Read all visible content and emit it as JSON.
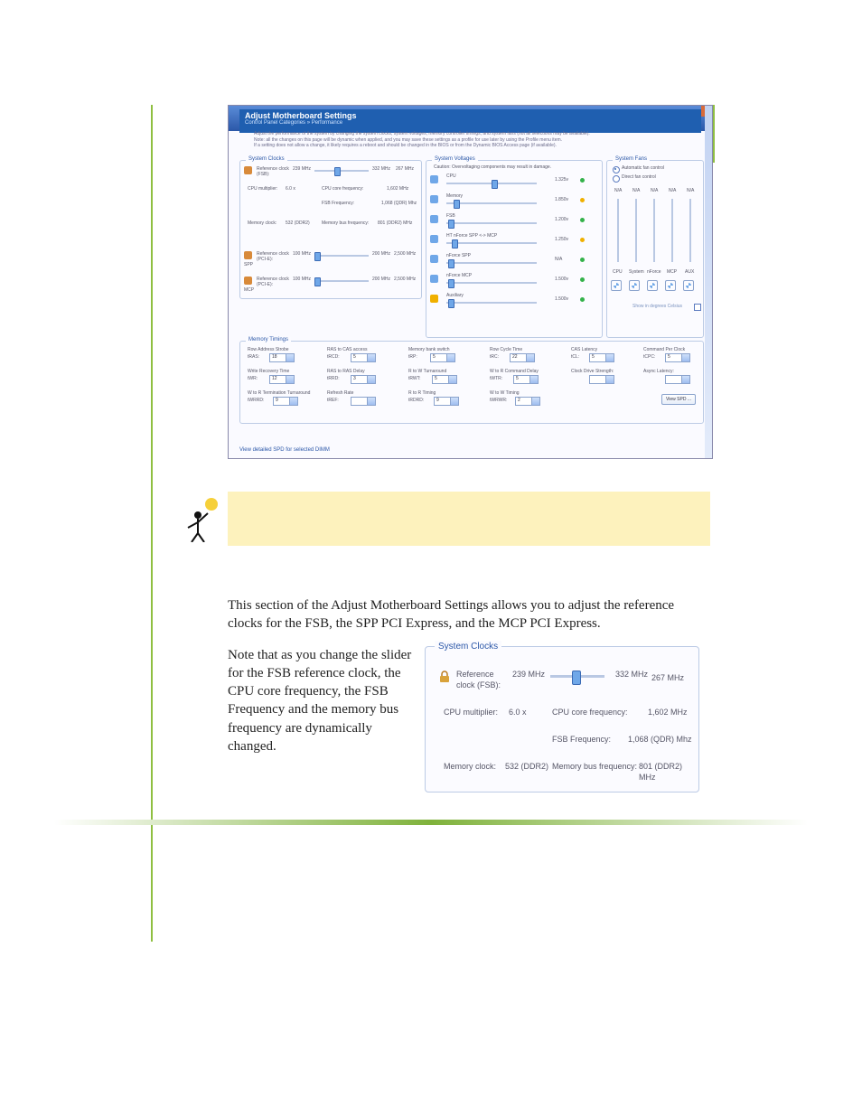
{
  "big": {
    "title": "Adjust Motherboard Settings",
    "breadcrumb": "Control Panel Categories  »  Performance",
    "desc1": "Adjust the performance of the system by changing the system clocks, system voltages, memory controller timings, and system fans (not all selections may be available).",
    "desc2": "Note: all the changes on this page will be dynamic when applied, and you may save these settings as a profile for use later by using the Profile menu item.",
    "desc3": "If a setting does not allow a change, it likely requires a reboot and should be changed in the BIOS or from the Dynamic BIOS Access page (if available).",
    "sysclocks": {
      "title": "System Clocks",
      "ref_fsb_lbl": "Reference clock (FSB):",
      "ref_fsb_val": "239 MHz",
      "ref_fsb_max": "332 MHz",
      "ref_fsb_rate": "267 MHz",
      "cpu_mult_lbl": "CPU multiplier:",
      "cpu_mult_val": "6.0 x",
      "cpu_core_lbl": "CPU core frequency:",
      "cpu_core_val": "1,602 MHz",
      "fsb_freq_lbl": "FSB Frequency:",
      "fsb_freq_val": "1,068 (QDR) Mhz",
      "mem_clk_lbl": "Memory clock:",
      "mem_clk_val": "532 (DDR2)",
      "mem_bus_lbl": "Memory bus frequency:",
      "mem_bus_val": "801 (DDR2) MHz",
      "spp_lbl": "SPP",
      "spp_ref_lbl": "Reference clock (PCI-E):",
      "spp_ref_val": "100 MHz",
      "spp_max": "200 MHz",
      "spp_result": "2,500 MHz",
      "mcp_lbl": "MCP",
      "mcp_ref_lbl": "Reference clock (PCI-E):",
      "mcp_ref_val": "100 MHz",
      "mcp_max": "200 MHz",
      "mcp_result": "2,500 MHz"
    },
    "volt": {
      "title": "System Voltages",
      "caution": "Caution: Overvoltaging components may result in damage.",
      "rows": [
        {
          "name": "CPU",
          "val": "1.325v"
        },
        {
          "name": "Memory",
          "val": "1.850v"
        },
        {
          "name": "FSB",
          "val": "1.200v"
        },
        {
          "name": "HT nForce SPP <-> MCP",
          "val": "1.250v"
        },
        {
          "name": "nForce SPP",
          "val": "N/A"
        },
        {
          "name": "nForce MCP",
          "val": "1.500v"
        },
        {
          "name": "Auxiliary",
          "val": "1.500v"
        }
      ]
    },
    "fans": {
      "title": "System Fans",
      "auto": "Automatic fan control",
      "direct": "Direct fan control",
      "na": "N/A",
      "show": "Show in degrees Celsius",
      "labels": [
        "CPU",
        "System",
        "nForce",
        "MCP",
        "AUX"
      ]
    },
    "mem": {
      "title": "Memory Timings",
      "rows": [
        {
          "l1": "Row Address Strobe",
          "k1": "tRAS:",
          "v1": "18",
          "l2": "RAS to CAS access",
          "k2": "tRCD:",
          "v2": "5",
          "l3": "Memory bank switch",
          "k3": "tRP:",
          "v3": "5",
          "l4": "Row Cycle Time",
          "k4": "tRC:",
          "v4": "22",
          "l5": "CAS Latency",
          "k5": "tCL:",
          "v5": "5",
          "l6": "Command Per Clock",
          "k6": "tCPC:",
          "v6": "5"
        },
        {
          "l1": "Write Recovery Time",
          "k1": "tWR:",
          "v1": "12",
          "l2": "RAS to RAS Delay",
          "k2": "tRRD:",
          "v2": "3",
          "l3": "R to W Turnaround",
          "k3": "tRWT:",
          "v3": "5",
          "l4": "W to R Command Delay",
          "k4": "tWTR:",
          "v4": "5",
          "l5": "Clock Drive Strength:",
          "k5": "",
          "v5": "",
          "l6": "Async Latency:",
          "k6": "",
          "v6": ""
        },
        {
          "l1": "W to R Termination Turnaround",
          "k1": "tWRRD:",
          "v1": "9",
          "l2": "Refresh Rate",
          "k2": "tREF:",
          "v2": "",
          "l3": "R to R Timing",
          "k3": "tRDRD:",
          "v3": "9",
          "l4": "W to W Timing",
          "k4": "tWRWR:",
          "v4": "2",
          "l5": "",
          "k5": "",
          "v5": "",
          "l6": "",
          "k6": "",
          "v6": ""
        }
      ],
      "btn": "View SPD  ..."
    },
    "footer": "View detailed SPD for selected DIMM"
  },
  "doc_para1": "This section of the Adjust Motherboard Settings allows you to adjust the reference clocks for the FSB, the SPP PCI Express, and the MCP PCI Express.",
  "doc_para2": "Note that as you change the slider for the FSB reference clock, the CPU core frequency, the FSB Frequency and the memory bus frequency are dynamically changed.",
  "mini": {
    "title": "System Clocks",
    "ref_lbl": "Reference clock (FSB):",
    "ref_val": "239 MHz",
    "ref_max": "332 MHz",
    "ref_rate": "267 MHz",
    "cpu_mult_lbl": "CPU multiplier:",
    "cpu_mult_val": "6.0 x",
    "cpu_core_lbl": "CPU core frequency:",
    "cpu_core_val": "1,602 MHz",
    "fsb_freq_lbl": "FSB Frequency:",
    "fsb_freq_val": "1,068 (QDR) Mhz",
    "mem_clk_lbl": "Memory clock:",
    "mem_clk_val": "532 (DDR2)",
    "mem_bus_lbl": "Memory bus frequency:",
    "mem_bus_val": "801 (DDR2) MHz"
  }
}
